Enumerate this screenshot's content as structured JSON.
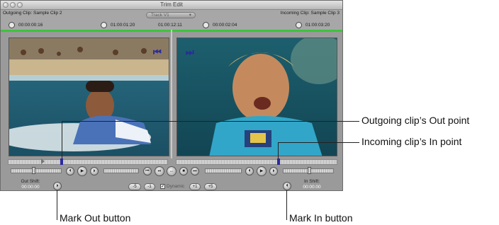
{
  "window": {
    "title": "Trim Edit"
  },
  "header": {
    "outgoing_label": "Outgoing Clip:",
    "outgoing_name": "Sample Clip 2",
    "incoming_label": "Incoming Clip:",
    "incoming_name": "Sample Clip 3",
    "track_popup": "Track V1",
    "tc_out_duration": "00:00:00:16",
    "tc_out_current": "01:00:01:20",
    "tc_center": "01:00:12:11",
    "tc_in_duration": "00:00:02:04",
    "tc_in_current": "01:00:03:20"
  },
  "transport": {
    "trim_minus5": "-5",
    "trim_minus1": "-1",
    "dynamic_label": "Dynamic",
    "trim_plus1": "+1",
    "trim_plus5": "+5"
  },
  "shift": {
    "out_label": "Out Shift:",
    "out_value": "00:00:00",
    "in_label": "In Shift:",
    "in_value": "00:00:00"
  },
  "callouts": {
    "outgoing_out_point": "Outgoing clip’s Out point",
    "incoming_in_point": "Incoming clip’s In point",
    "mark_out_button": "Mark Out button",
    "mark_in_button": "Mark In button"
  },
  "colors": {
    "track_line": "#3ec33e",
    "marker": "#2a2aa0",
    "window_bg": "#9a9a9a"
  },
  "icons": [
    "clock-icon",
    "play-icon",
    "mark-out-icon",
    "mark-in-icon"
  ]
}
